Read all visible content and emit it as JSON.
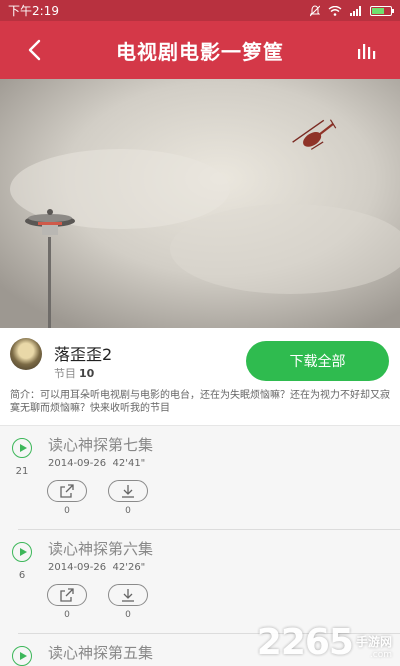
{
  "status_bar": {
    "time": "下午2:19"
  },
  "header": {
    "title": "电视剧电影一箩筐"
  },
  "podcast": {
    "name": "落歪歪2",
    "program_label": "节目",
    "program_count": "10",
    "download_all_label": "下载全部",
    "description": "简介：可以用耳朵听电视剧与电影的电台，还在为失眠烦恼嘛？还在为视力不好却又寂寞无聊而烦恼嘛？快来收听我的节目"
  },
  "episodes": [
    {
      "number": "21",
      "title": "读心神探第七集",
      "date": "2014-09-26",
      "duration": "42'41\"",
      "share_count": "0",
      "download_count": "0"
    },
    {
      "number": "6",
      "title": "读心神探第六集",
      "date": "2014-09-26",
      "duration": "42'26\"",
      "share_count": "0",
      "download_count": "0"
    },
    {
      "number": "",
      "title": "读心神探第五集",
      "date": "",
      "duration": "",
      "share_count": "",
      "download_count": ""
    }
  ],
  "watermark": {
    "text": "2265",
    "cn": "手游网",
    "domain": ".com"
  },
  "colors": {
    "header": "#d43848",
    "status_bar": "#b8313f",
    "accent_green": "#2fbb4f"
  },
  "icons": {
    "back": "chevron-left-icon",
    "equalizer": "equalizer-icon",
    "play": "play-icon",
    "share": "share-icon",
    "download": "download-icon"
  }
}
